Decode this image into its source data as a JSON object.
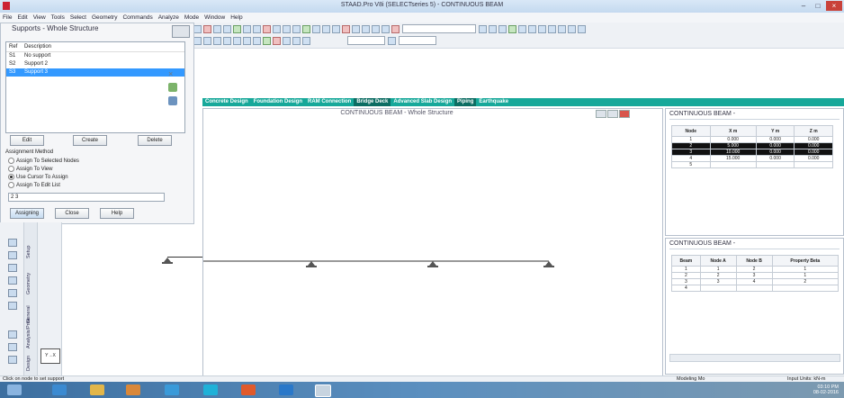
{
  "window": {
    "title": "STAAD.Pro V8i (SELECTseries 5) - CONTINUOUS BEAM"
  },
  "menu": [
    "File",
    "Edit",
    "View",
    "Tools",
    "Select",
    "Geometry",
    "Commands",
    "Analyze",
    "Mode",
    "Window",
    "Help"
  ],
  "support_panel": {
    "title": "Supports - Whole Structure",
    "col_ref": "Ref",
    "col_desc": "Description",
    "items": [
      {
        "ref": "S1",
        "desc": "No support"
      },
      {
        "ref": "S2",
        "desc": "Support 2"
      },
      {
        "ref": "S3",
        "desc": "Support 3"
      }
    ],
    "selected_index": 2,
    "buttons": {
      "edit": "Edit",
      "create": "Create",
      "delete": "Delete"
    },
    "assignment_method_label": "Assignment Method",
    "methods": [
      "Assign To Selected Nodes",
      "Assign To View",
      "Use Cursor To Assign",
      "Assign To Edit List"
    ],
    "selected_method": 2,
    "edit_list_value": "2 3",
    "action_buttons": {
      "assign": "Assigning",
      "close": "Close",
      "help": "Help"
    }
  },
  "tabs": [
    "Concrete Design",
    "Foundation Design",
    "RAM Connection",
    "Bridge Deck",
    "Advanced Slab Design",
    "Piping",
    "Earthquake"
  ],
  "viewport": {
    "title": "CONTINUOUS BEAM - Whole Structure"
  },
  "node_table": {
    "title": "CONTINUOUS BEAM -",
    "headers": [
      "Node",
      "X m",
      "Y m",
      "Z m"
    ],
    "rows": [
      [
        "1",
        "0.000",
        "0.000",
        "0.000"
      ],
      [
        "2",
        "5.000",
        "0.000",
        "0.000"
      ],
      [
        "3",
        "10.000",
        "0.000",
        "0.000"
      ],
      [
        "4",
        "15.000",
        "0.000",
        "0.000"
      ],
      [
        "5",
        "",
        "",
        ""
      ]
    ],
    "highlighted_rows": [
      1,
      2
    ]
  },
  "beam_table": {
    "title": "CONTINUOUS BEAM -",
    "headers": [
      "Beam",
      "Node A",
      "Node B",
      "Property Beta"
    ],
    "rows": [
      [
        "1",
        "1",
        "2",
        "1"
      ],
      [
        "2",
        "2",
        "3",
        "1"
      ],
      [
        "3",
        "3",
        "4",
        "2"
      ],
      [
        "4",
        "",
        "",
        ""
      ]
    ]
  },
  "sidebar_tabs": [
    "Setup",
    "Geometry",
    "General",
    "Analysis/Print",
    "Design"
  ],
  "status": {
    "left": "Click on node to set support",
    "middle": "Modeling Mo",
    "right": "Input Units: kN-m"
  },
  "taskbar": {
    "time": "03:10 PM",
    "date": "08-02-2016"
  },
  "colors": {
    "accent_tab": "#17a89a",
    "selection": "#3399ff",
    "taskbar": "#3d6fa0"
  }
}
